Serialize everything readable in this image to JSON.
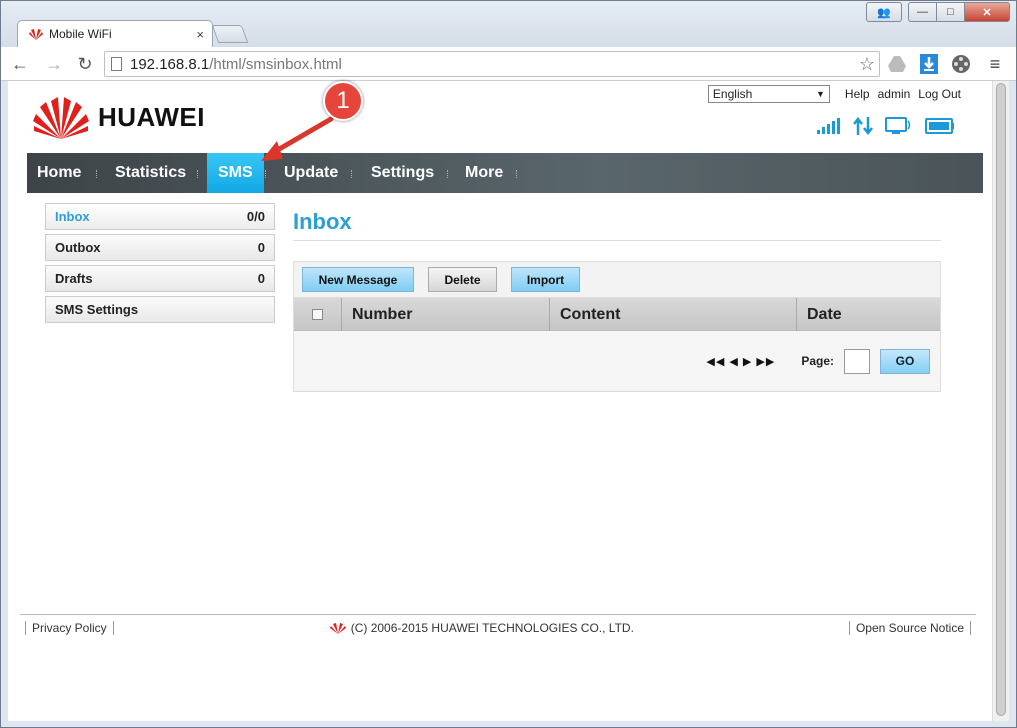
{
  "browser": {
    "tab_title": "Mobile WiFi",
    "tab_close": "×",
    "url_host": "192.168.8.1",
    "url_path": "/html/smsinbox.html"
  },
  "header": {
    "brand": "HUAWEI",
    "language": "English",
    "links": {
      "help": "Help",
      "admin": "admin",
      "logout": "Log Out"
    }
  },
  "nav": {
    "items": [
      "Home",
      "Statistics",
      "SMS",
      "Update",
      "Settings",
      "More"
    ],
    "active": "SMS"
  },
  "sidebar": {
    "items": [
      {
        "label": "Inbox",
        "count": "0/0"
      },
      {
        "label": "Outbox",
        "count": "0"
      },
      {
        "label": "Drafts",
        "count": "0"
      },
      {
        "label": "SMS Settings",
        "count": ""
      }
    ]
  },
  "main": {
    "title": "Inbox",
    "buttons": {
      "new_message": "New Message",
      "delete": "Delete",
      "import": "Import"
    },
    "columns": [
      "Number",
      "Content",
      "Date"
    ],
    "pager": {
      "arrows": "◀◀ ◀ ▶ ▶▶",
      "page_label": "Page:",
      "go": "GO"
    }
  },
  "annotation": {
    "number": "1"
  },
  "footer": {
    "privacy": "Privacy Policy",
    "copyright": "(C) 2006-2015 HUAWEI TECHNOLOGIES CO., LTD.",
    "open_source": "Open Source Notice"
  },
  "colors": {
    "accent": "#2b9fd6",
    "active_tab": "#1eb1ec",
    "brand_red": "#e0201b",
    "annotation": "#e5453a"
  }
}
